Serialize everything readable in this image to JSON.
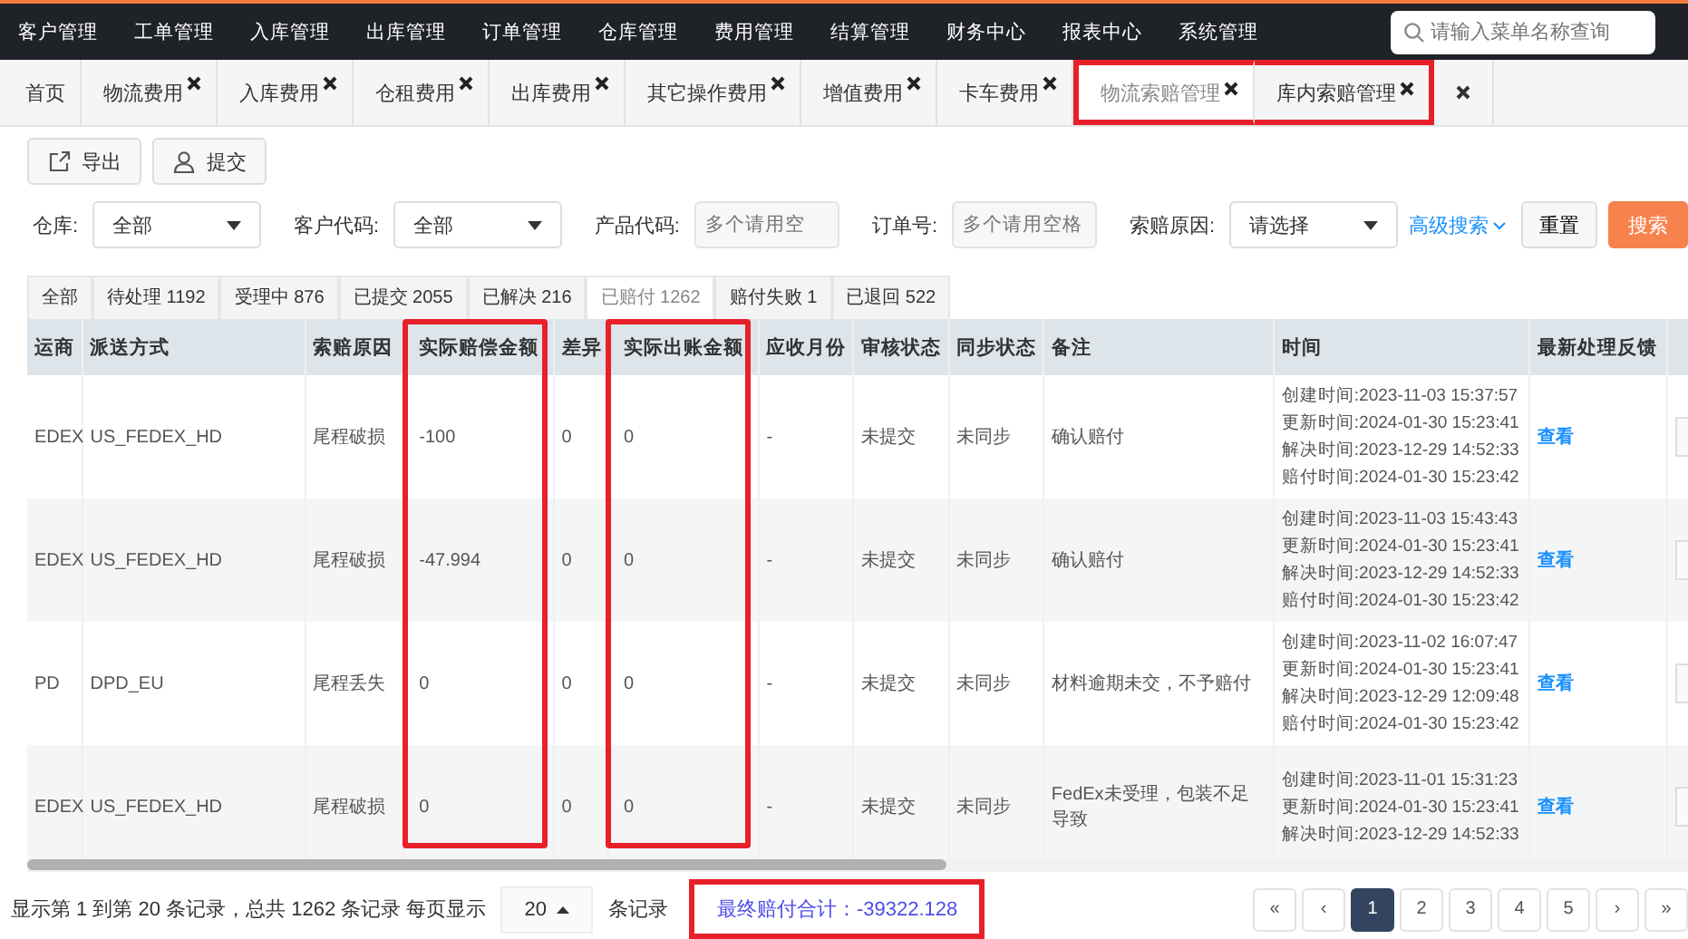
{
  "top_nav": {
    "items": [
      "客户管理",
      "工单管理",
      "入库管理",
      "出库管理",
      "订单管理",
      "仓库管理",
      "费用管理",
      "结算管理",
      "财务中心",
      "报表中心",
      "系统管理"
    ],
    "search": {
      "placeholder": "请输入菜单名称查询"
    }
  },
  "page_tabs": [
    {
      "label": "首页",
      "selected": false,
      "closable": false,
      "highlighted": false
    },
    {
      "label": "物流费用",
      "selected": false,
      "closable": true,
      "highlighted": false
    },
    {
      "label": "入库费用",
      "selected": false,
      "closable": true,
      "highlighted": false
    },
    {
      "label": "仓租费用",
      "selected": false,
      "closable": true,
      "highlighted": false
    },
    {
      "label": "出库费用",
      "selected": false,
      "closable": true,
      "highlighted": false
    },
    {
      "label": "其它操作费用",
      "selected": false,
      "closable": true,
      "highlighted": false
    },
    {
      "label": "增值费用",
      "selected": false,
      "closable": true,
      "highlighted": false
    },
    {
      "label": "卡车费用",
      "selected": false,
      "closable": true,
      "highlighted": false
    },
    {
      "label": "物流索赔管理",
      "selected": true,
      "closable": true,
      "highlighted": true
    },
    {
      "label": "库内索赔管理",
      "selected": false,
      "closable": true,
      "highlighted": true
    }
  ],
  "toolbar": [
    {
      "label": "导出",
      "kind": "export"
    },
    {
      "label": "提交",
      "kind": "user"
    }
  ],
  "filters": [
    {
      "label": "仓库:",
      "kind": "select",
      "value": "全部"
    },
    {
      "label": "客户代码:",
      "kind": "select",
      "value": "全部"
    },
    {
      "label": "产品代码:",
      "kind": "input",
      "placeholder": "多个请用空"
    },
    {
      "label": "订单号:",
      "kind": "input",
      "placeholder": "多个请用空格"
    },
    {
      "label": "索赔原因:",
      "kind": "select",
      "value": "请选择"
    }
  ],
  "advanced_search": "高级搜索",
  "reset_button": "重置",
  "search_button": "搜索",
  "status_tabs": [
    {
      "label": "全部",
      "selected": false
    },
    {
      "label": "待处理 1192",
      "selected": false
    },
    {
      "label": "受理中 876",
      "selected": false
    },
    {
      "label": "已提交 2055",
      "selected": false
    },
    {
      "label": "已解决 216",
      "selected": false
    },
    {
      "label": "已赔付 1262",
      "selected": true
    },
    {
      "label": "赔付失败 1",
      "selected": false
    },
    {
      "label": "已退回 522",
      "selected": false
    }
  ],
  "table": {
    "columns": [
      {
        "label": "运商",
        "kind": "text",
        "highlighted": false
      },
      {
        "label": "派送方式",
        "kind": "text",
        "highlighted": false
      },
      {
        "label": "索赔原因",
        "kind": "text",
        "highlighted": false
      },
      {
        "label": "实际赔偿金额",
        "kind": "text",
        "highlighted": true
      },
      {
        "label": "差异",
        "kind": "text",
        "highlighted": false
      },
      {
        "label": "实际出账金额",
        "kind": "text",
        "highlighted": true
      },
      {
        "label": "应收月份",
        "kind": "text",
        "highlighted": false
      },
      {
        "label": "审核状态",
        "kind": "text",
        "highlighted": false
      },
      {
        "label": "同步状态",
        "kind": "text",
        "highlighted": false
      },
      {
        "label": "备注",
        "kind": "text",
        "highlighted": false
      },
      {
        "label": "时间",
        "kind": "times",
        "highlighted": false
      },
      {
        "label": "最新处理反馈",
        "kind": "link",
        "highlighted": false
      }
    ],
    "rows": [
      {
        "cells": [
          "EDEX",
          "US_FEDEX_HD",
          "尾程破损",
          "-100",
          "0",
          "0",
          "-",
          "未提交",
          "未同步",
          "确认赔付",
          [
            "创建时间:2023-11-03 15:37:57",
            "更新时间:2024-01-30 15:23:41",
            "解决时间:2023-12-29 14:52:33",
            "赔付时间:2024-01-30 15:23:42"
          ],
          "查看"
        ]
      },
      {
        "cells": [
          "EDEX",
          "US_FEDEX_HD",
          "尾程破损",
          "-47.994",
          "0",
          "0",
          "-",
          "未提交",
          "未同步",
          "确认赔付",
          [
            "创建时间:2023-11-03 15:43:43",
            "更新时间:2024-01-30 15:23:41",
            "解决时间:2023-12-29 14:52:33",
            "赔付时间:2024-01-30 15:23:42"
          ],
          "查看"
        ]
      },
      {
        "cells": [
          "PD",
          "DPD_EU",
          "尾程丢失",
          "0",
          "0",
          "0",
          "-",
          "未提交",
          "未同步",
          "材料逾期未交，不予赔付",
          [
            "创建时间:2023-11-02 16:07:47",
            "更新时间:2024-01-30 15:23:41",
            "解决时间:2023-12-29 12:09:48",
            "赔付时间:2024-01-30 15:23:42"
          ],
          "查看"
        ]
      },
      {
        "cells": [
          "EDEX",
          "US_FEDEX_HD",
          "尾程破损",
          "0",
          "0",
          "0",
          "-",
          "未提交",
          "未同步",
          "FedEx未受理，包装不足导致",
          [
            "创建时间:2023-11-01 15:31:23",
            "更新时间:2024-01-30 15:23:41",
            "解决时间:2023-12-29 14:52:33"
          ],
          "查看"
        ]
      }
    ]
  },
  "footer": {
    "summary": "显示第 1 到第 20 条记录，总共 1262 条记录 每页显示",
    "page_size": "20",
    "suffix": "条记录",
    "total": {
      "text": "最终赔付合计：-39322.128",
      "highlighted": true
    }
  },
  "pagination": [
    {
      "label": "«",
      "selected": false
    },
    {
      "label": "‹",
      "selected": false
    },
    {
      "label": "1",
      "selected": true
    },
    {
      "label": "2",
      "selected": false
    },
    {
      "label": "3",
      "selected": false
    },
    {
      "label": "4",
      "selected": false
    },
    {
      "label": "5",
      "selected": false
    },
    {
      "label": "›",
      "selected": false
    },
    {
      "label": "»",
      "selected": false
    }
  ]
}
